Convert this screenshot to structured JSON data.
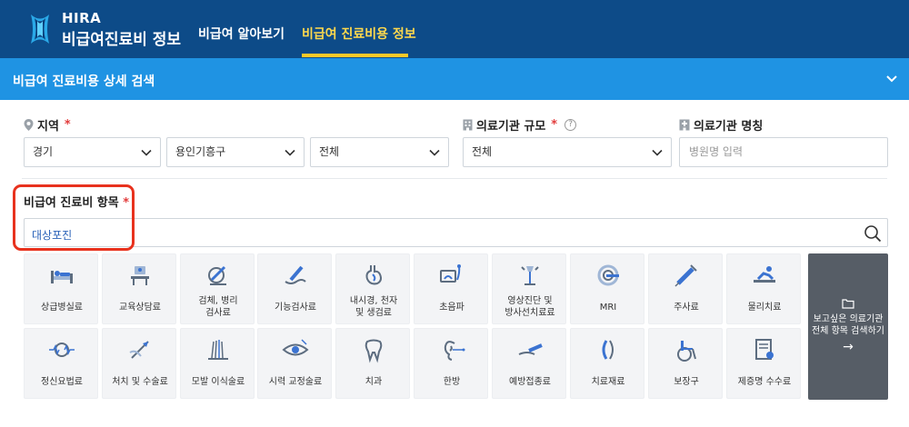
{
  "header": {
    "brand_top": "HIRA",
    "brand_bottom": "비급여진료비 정보",
    "nav": [
      {
        "label": "비급여 알아보기"
      },
      {
        "label": "비급여 진료비용 정보"
      }
    ]
  },
  "section": {
    "title": "비급여 진료비용 상세 검색"
  },
  "filters": {
    "region": {
      "label": "지역",
      "required": "*",
      "selects": [
        "경기",
        "용인기흥구",
        "전체"
      ]
    },
    "scale": {
      "label": "의료기관 규모",
      "required": "*",
      "help": "?",
      "value": "전체"
    },
    "name": {
      "label": "의료기관 명칭",
      "placeholder": "병원명 입력"
    }
  },
  "items": {
    "label": "비급여 진료비 항목",
    "required": "*",
    "search_value": "대상포진",
    "categories": [
      [
        "상급병실료"
      ],
      [
        "교육상담료"
      ],
      [
        "검체, 병리",
        "검사료"
      ],
      [
        "기능검사료"
      ],
      [
        "내시경, 천자",
        "및 생검료"
      ],
      [
        "초음파"
      ],
      [
        "영상진단 및",
        "방사선치료료"
      ],
      [
        "MRI"
      ],
      [
        "주사료"
      ],
      [
        "물리치료"
      ],
      [
        "정신요법료"
      ],
      [
        "처치 및 수술료"
      ],
      [
        "모발 이식술료"
      ],
      [
        "시력 교정술료"
      ],
      [
        "치과"
      ],
      [
        "한방"
      ],
      [
        "예방접종료"
      ],
      [
        "치료재료"
      ],
      [
        "보장구"
      ],
      [
        "제증명 수수료"
      ]
    ],
    "view_all": {
      "line1": "보고싶은 의료기관",
      "line2": "전체 항목 검색하기",
      "arrow": "→"
    }
  },
  "colors": {
    "header_bg": "#0d4b88",
    "section_bg": "#1f93e3",
    "active_nav": "#ffd94d",
    "required": "#e23b3b",
    "icon_blue": "#3b73d1",
    "highlight": "#e8321e"
  }
}
